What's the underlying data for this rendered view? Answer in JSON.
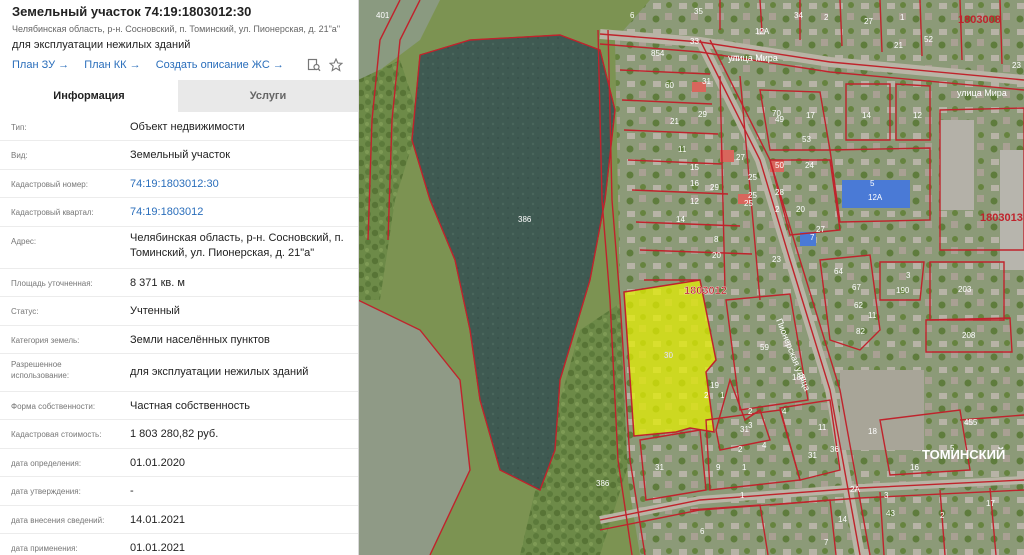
{
  "header": {
    "title": "Земельный участок 74:19:1803012:30",
    "address": "Челябинская область, р-н. Сосновский, п. Томинский, ул. Пионерская, д. 21\"а\"",
    "purpose": "для эксплуатации нежилых зданий",
    "links": [
      "План ЗУ →",
      "План КК →",
      "Создать описание ЖС →"
    ]
  },
  "tabs": [
    "Информация",
    "Услуги"
  ],
  "rows": [
    {
      "label": "Тип:",
      "value": "Объект недвижимости"
    },
    {
      "label": "Вид:",
      "value": "Земельный участок"
    },
    {
      "label": "Кадастровый номер:",
      "value": "74:19:1803012:30"
    },
    {
      "label": "Кадастровый квартал:",
      "value": "74:19:1803012"
    },
    {
      "label": "Адрес:",
      "value": "Челябинская область, р-н. Сосновский, п. Томинский, ул. Пионерская, д. 21\"а\""
    },
    {
      "label": "Площадь уточненная:",
      "value": "8 371 кв. м"
    },
    {
      "label": "Статус:",
      "value": "Учтенный"
    },
    {
      "label": "Категория земель:",
      "value": "Земли населённых пунктов"
    },
    {
      "label": "Разрешенное использование:",
      "value": "для эксплуатации нежилых зданий"
    },
    {
      "label": "Форма собственности:",
      "value": "Частная собственность"
    },
    {
      "label": "Кадастровая стоимость:",
      "value": "1 803 280,82 руб."
    },
    {
      "label": "дата определения:",
      "value": "01.01.2020"
    },
    {
      "label": "дата утверждения:",
      "value": "-"
    },
    {
      "label": "дата внесения сведений:",
      "value": "14.01.2021"
    },
    {
      "label": "дата применения:",
      "value": "01.01.2021"
    }
  ],
  "map": {
    "quarter_labels": [
      "1803008",
      "1803013",
      "1803012"
    ],
    "street_labels": [
      "улица Мира",
      "улица Мира",
      "Пионерская улица"
    ],
    "settlement_label": "ТОМИНСКИЙ",
    "lake_parcel": "386",
    "shore_parcel": "386",
    "selected_parcel": "30",
    "parcel_numbers": [
      "401",
      "6",
      "35",
      "12А",
      "34",
      "2",
      "27",
      "1",
      "52",
      "21",
      "23",
      "33",
      "854",
      "60",
      "31",
      "30",
      "70",
      "53",
      "14",
      "12",
      "21",
      "29",
      "49",
      "17",
      "11",
      "27",
      "50",
      "24",
      "15",
      "25",
      "28",
      "5",
      "12А",
      "16",
      "25",
      "2",
      "20",
      "12",
      "25",
      "29",
      "14",
      "23",
      "8",
      "20",
      "7",
      "27",
      "64",
      "3",
      "190",
      "203",
      "67",
      "62",
      "11",
      "82",
      "208",
      "59",
      "19",
      "18А",
      "2",
      "2",
      "4",
      "1",
      "9",
      "1",
      "31",
      "31",
      "11",
      "36",
      "3",
      "455",
      "18",
      "5",
      "16",
      "4",
      "31",
      "2",
      "1",
      "2А",
      "3",
      "43",
      "14",
      "17",
      "2",
      "7",
      "6"
    ],
    "colors": {
      "boundary": "#c0232c",
      "selection_fill": "#e6f000",
      "water": "#3e5a50",
      "grass": "#7b9350"
    }
  },
  "icons": {
    "print": "print-search-icon",
    "star": "star-icon"
  }
}
